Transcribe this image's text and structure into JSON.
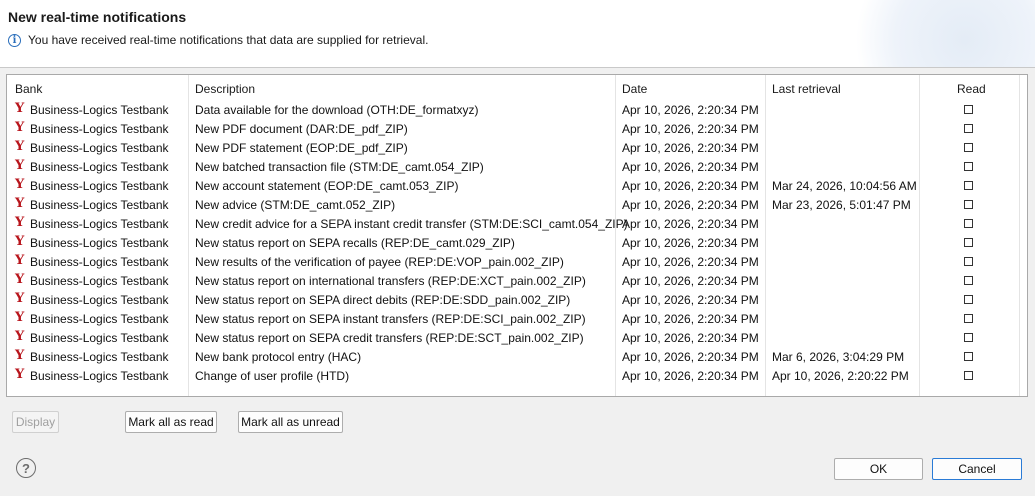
{
  "dialog": {
    "title": "New real-time notifications",
    "subtitle": "You have received real-time notifications that data are supplied for retrieval."
  },
  "icons": {
    "info": "info-icon",
    "bank": "bank-logo-icon",
    "help": "help-icon"
  },
  "colors": {
    "bank_logo": "#b8151c",
    "info": "#2a6ebb",
    "primary_border": "#2a7bd6"
  },
  "table": {
    "columns": [
      "Bank",
      "Description",
      "Date",
      "Last retrieval",
      "Read"
    ],
    "rows": [
      {
        "bank": "Business-Logics Testbank",
        "description": "Data available for the download (OTH:DE_formatxyz)",
        "date": "Apr 10, 2026, 2:20:34 PM",
        "last_retrieval": "",
        "read": false
      },
      {
        "bank": "Business-Logics Testbank",
        "description": "New PDF document (DAR:DE_pdf_ZIP)",
        "date": "Apr 10, 2026, 2:20:34 PM",
        "last_retrieval": "",
        "read": false
      },
      {
        "bank": "Business-Logics Testbank",
        "description": "New PDF statement (EOP:DE_pdf_ZIP)",
        "date": "Apr 10, 2026, 2:20:34 PM",
        "last_retrieval": "",
        "read": false
      },
      {
        "bank": "Business-Logics Testbank",
        "description": "New batched transaction file (STM:DE_camt.054_ZIP)",
        "date": "Apr 10, 2026, 2:20:34 PM",
        "last_retrieval": "",
        "read": false
      },
      {
        "bank": "Business-Logics Testbank",
        "description": "New account statement (EOP:DE_camt.053_ZIP)",
        "date": "Apr 10, 2026, 2:20:34 PM",
        "last_retrieval": "Mar 24, 2026, 10:04:56 AM",
        "read": false
      },
      {
        "bank": "Business-Logics Testbank",
        "description": "New advice (STM:DE_camt.052_ZIP)",
        "date": "Apr 10, 2026, 2:20:34 PM",
        "last_retrieval": "Mar 23, 2026, 5:01:47 PM",
        "read": false
      },
      {
        "bank": "Business-Logics Testbank",
        "description": "New credit advice for a SEPA instant credit transfer (STM:DE:SCI_camt.054_ZIP)",
        "date": "Apr 10, 2026, 2:20:34 PM",
        "last_retrieval": "",
        "read": false
      },
      {
        "bank": "Business-Logics Testbank",
        "description": "New status report on SEPA recalls (REP:DE_camt.029_ZIP)",
        "date": "Apr 10, 2026, 2:20:34 PM",
        "last_retrieval": "",
        "read": false
      },
      {
        "bank": "Business-Logics Testbank",
        "description": "New results of the verification of payee (REP:DE:VOP_pain.002_ZIP)",
        "date": "Apr 10, 2026, 2:20:34 PM",
        "last_retrieval": "",
        "read": false
      },
      {
        "bank": "Business-Logics Testbank",
        "description": "New status report on international transfers (REP:DE:XCT_pain.002_ZIP)",
        "date": "Apr 10, 2026, 2:20:34 PM",
        "last_retrieval": "",
        "read": false
      },
      {
        "bank": "Business-Logics Testbank",
        "description": "New status report on SEPA direct debits (REP:DE:SDD_pain.002_ZIP)",
        "date": "Apr 10, 2026, 2:20:34 PM",
        "last_retrieval": "",
        "read": false
      },
      {
        "bank": "Business-Logics Testbank",
        "description": "New status report on SEPA instant transfers (REP:DE:SCI_pain.002_ZIP)",
        "date": "Apr 10, 2026, 2:20:34 PM",
        "last_retrieval": "",
        "read": false
      },
      {
        "bank": "Business-Logics Testbank",
        "description": "New status report on SEPA credit transfers (REP:DE:SCT_pain.002_ZIP)",
        "date": "Apr 10, 2026, 2:20:34 PM",
        "last_retrieval": "",
        "read": false
      },
      {
        "bank": "Business-Logics Testbank",
        "description": "New bank protocol entry (HAC)",
        "date": "Apr 10, 2026, 2:20:34 PM",
        "last_retrieval": "Mar 6, 2026, 3:04:29 PM",
        "read": false
      },
      {
        "bank": "Business-Logics Testbank",
        "description": "Change of user profile (HTD)",
        "date": "Apr 10, 2026, 2:20:34 PM",
        "last_retrieval": "Apr 10, 2026, 2:20:22 PM",
        "read": false
      }
    ]
  },
  "buttons": {
    "display": "Display",
    "mark_all_read": "Mark all as read",
    "mark_all_unread": "Mark all as unread",
    "ok": "OK",
    "cancel": "Cancel"
  }
}
